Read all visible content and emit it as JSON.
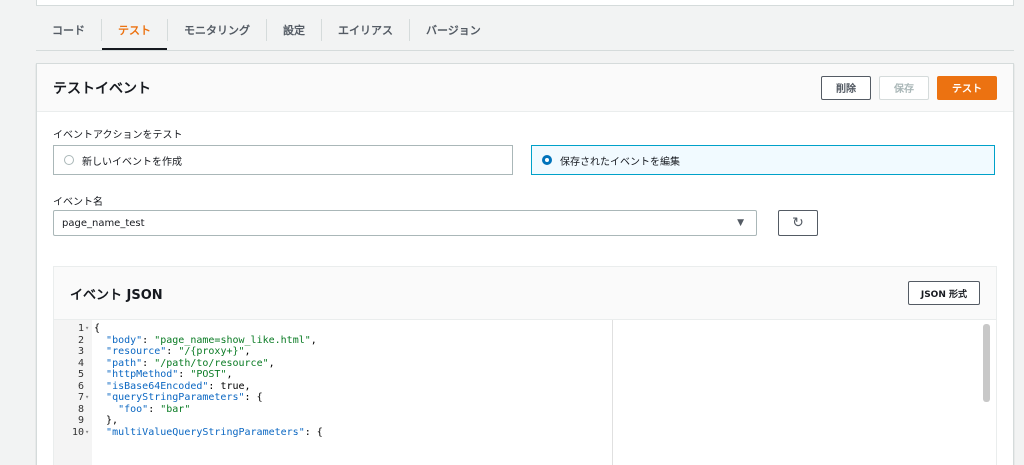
{
  "tabs": [
    {
      "label": "コード",
      "active": false
    },
    {
      "label": "テスト",
      "active": true
    },
    {
      "label": "モニタリング",
      "active": false
    },
    {
      "label": "設定",
      "active": false
    },
    {
      "label": "エイリアス",
      "active": false
    },
    {
      "label": "バージョン",
      "active": false
    }
  ],
  "test_event": {
    "title": "テストイベント",
    "delete_label": "削除",
    "save_label": "保存",
    "test_label": "テスト",
    "action_label": "イベントアクションをテスト",
    "option_new": "新しいイベントを作成",
    "option_saved": "保存されたイベントを編集",
    "selected_option": "保存されたイベントを編集",
    "event_name_label": "イベント名",
    "event_name_value": "page_name_test"
  },
  "event_json": {
    "title": "イベント JSON",
    "format_button": "JSON 形式",
    "lines": [
      {
        "n": "1",
        "fold": true,
        "text": "{"
      },
      {
        "n": "2",
        "fold": false,
        "text": "  \"body\": \"page_name=show_like.html\","
      },
      {
        "n": "3",
        "fold": false,
        "text": "  \"resource\": \"/{proxy+}\","
      },
      {
        "n": "4",
        "fold": false,
        "text": "  \"path\": \"/path/to/resource\","
      },
      {
        "n": "5",
        "fold": false,
        "text": "  \"httpMethod\": \"POST\","
      },
      {
        "n": "6",
        "fold": false,
        "text": "  \"isBase64Encoded\": true,"
      },
      {
        "n": "7",
        "fold": true,
        "text": "  \"queryStringParameters\": {"
      },
      {
        "n": "8",
        "fold": false,
        "text": "    \"foo\": \"bar\""
      },
      {
        "n": "9",
        "fold": false,
        "text": "  },"
      },
      {
        "n": "10",
        "fold": true,
        "text": "  \"multiValueQueryStringParameters\": {"
      }
    ]
  },
  "colors": {
    "accent": "#ec7211",
    "selected_border": "#00a1c9",
    "radio_on": "#0073bb"
  }
}
